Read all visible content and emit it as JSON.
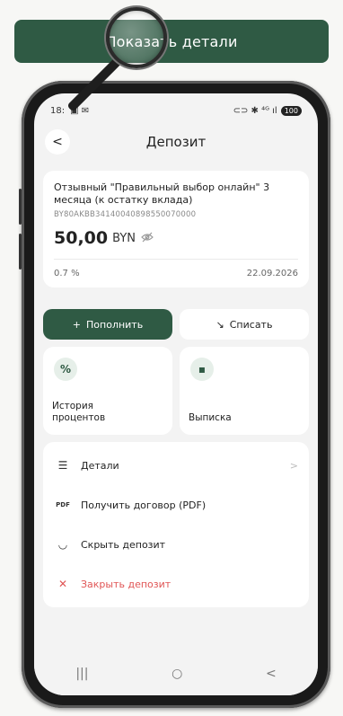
{
  "top_button": {
    "label": "Показать детали"
  },
  "status_bar": {
    "time": "18:",
    "icons_left": "▣ ✉",
    "icons_right": "⊂⊃ ✱ ⁴ᴳ ıl",
    "battery": "100"
  },
  "header": {
    "title": "Депозит",
    "back": "<"
  },
  "deposit": {
    "name": "Отзывный \"Правильный выбор онлайн\" 3 месяца (к остатку вклада)",
    "account": "BY80AKBB34140040898550070000",
    "amount": "50,00",
    "currency": "BYN",
    "rate": "0.7 %",
    "end_date": "22.09.2026"
  },
  "actions": {
    "topup_icon": "+",
    "topup_label": "Пополнить",
    "withdraw_icon": "↘",
    "withdraw_label": "Списать"
  },
  "tiles": [
    {
      "icon": "%",
      "label": "История процентов"
    },
    {
      "icon": "▪",
      "label": "Выписка"
    }
  ],
  "menu": [
    {
      "icon": "☰",
      "label": "Детали",
      "chevron": ">"
    },
    {
      "icon": "PDF",
      "label": "Получить договор (PDF)"
    },
    {
      "icon": "◡",
      "label": "Скрыть депозит"
    },
    {
      "icon": "✕",
      "label": "Закрыть депозит"
    }
  ],
  "nav": {
    "recent": "|||",
    "home": "○",
    "back": "<"
  },
  "colors": {
    "primary": "#2f5a44",
    "danger": "#e05555",
    "background": "#f3f3f3"
  }
}
